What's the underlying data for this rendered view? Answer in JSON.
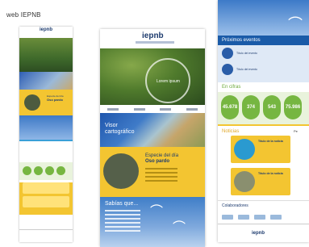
{
  "caption": "web IEPNB",
  "mock1": {
    "logo": "iepnb",
    "species_kicker": "Especie del día",
    "species_name": "Oso pardo"
  },
  "mock2": {
    "logo": "iepnb",
    "hero_text": "Lorem ipsum",
    "map_title": "Visor cartográfico",
    "species_kicker": "Especie del día",
    "species_name": "Oso pardo",
    "sky_title": "Sabías que..."
  },
  "mock3": {
    "events_title": "Próximos eventos",
    "event_1": "Título del evento",
    "event_2": "Título del evento",
    "cifras_title": "En cifras",
    "cifras": [
      "45.678",
      "374",
      "543",
      "75.986"
    ],
    "news_title": "Noticias",
    "news_side": "Pe",
    "news_1": "Título de la noticia",
    "news_2": "Título de la noticia",
    "collab_title": "Colaboradores",
    "footer_logo": "iepnb"
  },
  "colors": {
    "brand_blue": "#1d3b6e",
    "accent_yellow": "#f3c531",
    "accent_green": "#76b641"
  }
}
